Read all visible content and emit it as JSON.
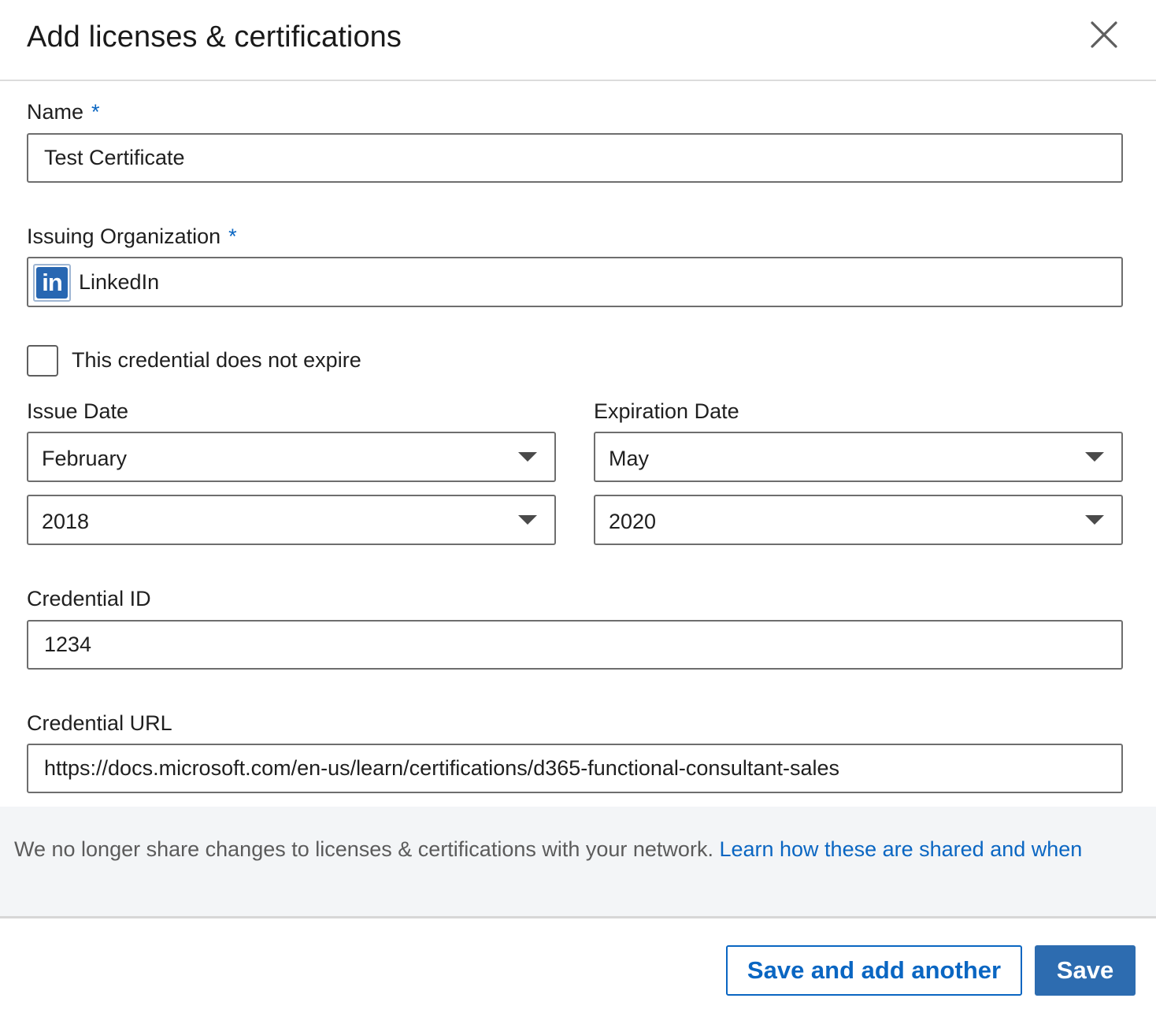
{
  "dialog": {
    "title": "Add licenses & certifications",
    "close_icon": "close-icon"
  },
  "form": {
    "name": {
      "label": "Name",
      "required_marker": "*",
      "value": "Test Certificate"
    },
    "issuing_organization": {
      "label": "Issuing Organization",
      "required_marker": "*",
      "logo_text": "in",
      "logo_color": "#2867b2",
      "value": "LinkedIn"
    },
    "no_expire_checkbox": {
      "label": "This credential does not expire",
      "checked": false
    },
    "issue_date": {
      "label": "Issue Date",
      "month": "February",
      "year": "2018"
    },
    "expiration_date": {
      "label": "Expiration Date",
      "month": "May",
      "year": "2020"
    },
    "credential_id": {
      "label": "Credential ID",
      "value": "1234"
    },
    "credential_url": {
      "label": "Credential URL",
      "value": "https://docs.microsoft.com/en-us/learn/certifications/d365-functional-consultant-sales"
    }
  },
  "notice": {
    "text": "We no longer share changes to licenses & certifications with your network.",
    "link": "Learn how these are shared and when"
  },
  "footer": {
    "save_and_add_label": "Save and add another",
    "save_label": "Save"
  },
  "colors": {
    "accent": "#0a66c2",
    "primary_button": "#2d6cb0",
    "notice_background": "#f3f5f7"
  }
}
